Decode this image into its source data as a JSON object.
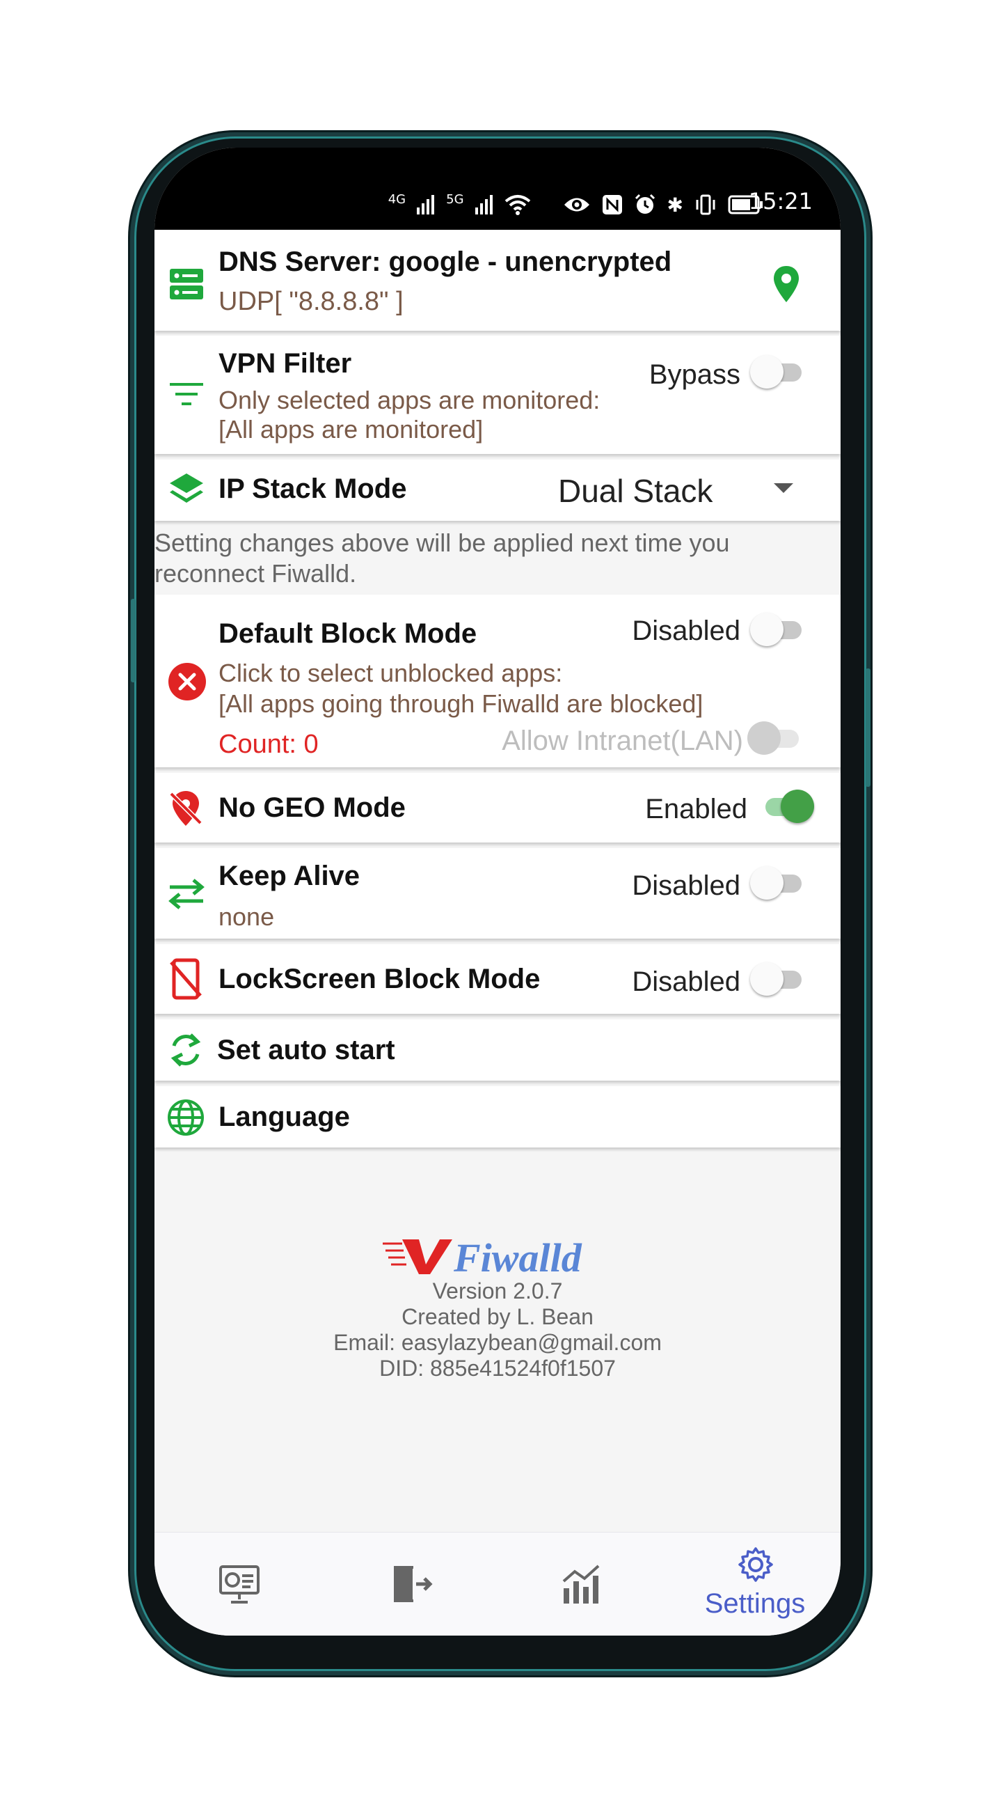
{
  "status_bar": {
    "signal_1": "4G",
    "signal_2": "5G",
    "time": "15:21"
  },
  "dns": {
    "title": "DNS Server: google - unencrypted",
    "subtitle": "UDP[ \"8.8.8.8\" ]",
    "icon": "server-icon",
    "action_icon": "location-pin-icon"
  },
  "vpn_filter": {
    "title": "VPN Filter",
    "line1": "Only selected apps are monitored:",
    "line2": "[All apps are monitored]",
    "toggle_label": "Bypass",
    "toggle_on": false
  },
  "ip_stack": {
    "title": "IP Stack Mode",
    "value": "Dual Stack"
  },
  "note": {
    "line1": "Setting changes above will be applied next time you",
    "line2": "reconnect Fiwalld."
  },
  "default_block": {
    "title": "Default Block Mode",
    "line1": "Click to select unblocked apps:",
    "line2": "[All apps going through Fiwalld are blocked]",
    "count": "Count: 0",
    "toggle_label": "Disabled",
    "toggle_on": false,
    "lan_label": "Allow Intranet(LAN)",
    "lan_on": false
  },
  "no_geo": {
    "title": "No GEO Mode",
    "toggle_label": "Enabled",
    "toggle_on": true
  },
  "keep_alive": {
    "title": "Keep Alive",
    "subtitle": "none",
    "toggle_label": "Disabled",
    "toggle_on": false
  },
  "lockscreen": {
    "title": "LockScreen Block Mode",
    "toggle_label": "Disabled",
    "toggle_on": false
  },
  "auto_start": {
    "title": "Set auto start"
  },
  "language": {
    "title": "Language"
  },
  "footer": {
    "logo_text": "Fiwalld",
    "version": "Version 2.0.7",
    "creator": "Created by L. Bean",
    "email": "Email: easylazybean@gmail.com",
    "did": "DID: 885e41524f0f1507"
  },
  "colors": {
    "accent_green": "#1fa83c",
    "red": "#e02424",
    "nav_blue": "#4a5dc8",
    "subtitle_brown": "#7a5a48"
  },
  "bottom_nav": {
    "items": [
      {
        "icon": "dashboard-icon",
        "label": ""
      },
      {
        "icon": "exit-icon",
        "label": ""
      },
      {
        "icon": "stats-icon",
        "label": ""
      },
      {
        "icon": "gear-icon",
        "label": "Settings",
        "active": true
      }
    ]
  }
}
